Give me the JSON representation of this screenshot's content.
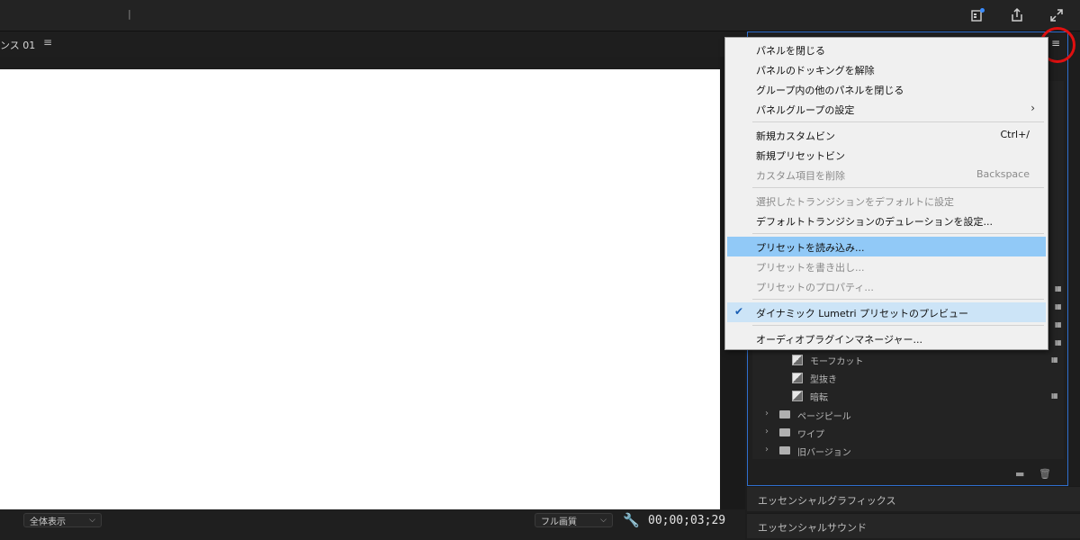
{
  "sequence": {
    "tab_label": "ンス 01",
    "menu_glyph": "≡"
  },
  "monitor_footer": {
    "fit_dropdown": "全体表示",
    "quality_dropdown": "フル画質",
    "timecode": "00;00;03;29"
  },
  "context_menu": {
    "items": [
      {
        "label": "パネルを閉じる",
        "shortcut": "",
        "disabled": false
      },
      {
        "label": "パネルのドッキングを解除",
        "shortcut": "",
        "disabled": false
      },
      {
        "label": "グループ内の他のパネルを閉じる",
        "shortcut": "",
        "disabled": false
      },
      {
        "label": "パネルグループの設定",
        "shortcut": "",
        "disabled": false,
        "submenu": true
      },
      {
        "label": "新規カスタムビン",
        "shortcut": "Ctrl+/",
        "disabled": false
      },
      {
        "label": "新規プリセットビン",
        "shortcut": "",
        "disabled": false
      },
      {
        "label": "カスタム項目を削除",
        "shortcut": "Backspace",
        "disabled": true
      },
      {
        "label": "選択したトランジションをデフォルトに設定",
        "shortcut": "",
        "disabled": true
      },
      {
        "label": "デフォルトトランジションのデュレーションを設定...",
        "shortcut": "",
        "disabled": false
      },
      {
        "label": "プリセットを読み込み...",
        "shortcut": "",
        "disabled": false,
        "highlighted": true
      },
      {
        "label": "プリセットを書き出し...",
        "shortcut": "",
        "disabled": true
      },
      {
        "label": "プリセットのプロパティ...",
        "shortcut": "",
        "disabled": true
      },
      {
        "label": "ダイナミック Lumetri プリセットのプレビュー",
        "shortcut": "",
        "disabled": false,
        "checked": true
      },
      {
        "label": "オーディオプラグインマネージャー...",
        "shortcut": "",
        "disabled": false
      }
    ]
  },
  "effects_tree": {
    "presets": [
      {
        "label": "モーフカット",
        "badge": true
      },
      {
        "label": "型抜き",
        "badge": false
      },
      {
        "label": "暗転",
        "badge": true
      }
    ],
    "folders": [
      {
        "label": "ページピール"
      },
      {
        "label": "ワイプ"
      },
      {
        "label": "旧バージョン"
      }
    ]
  },
  "sections": {
    "essential_graphics": "エッセンシャルグラフィックス",
    "essential_sound": "エッセンシャルサウンド"
  },
  "colors": {
    "accent_blue": "#2f6fcf",
    "highlight_red": "#e01010",
    "menu_highlight": "#91c9f7",
    "menu_checked_bg": "#cce4f7"
  }
}
